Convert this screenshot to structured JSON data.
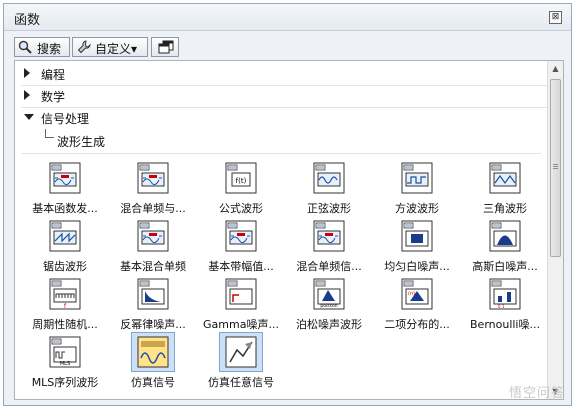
{
  "window": {
    "title": "函数",
    "close_glyph": "⊠"
  },
  "toolbar": {
    "search_label": "搜索",
    "customize_label": "自定义▾"
  },
  "categories": [
    {
      "label": "编程",
      "expanded": false
    },
    {
      "label": "数学",
      "expanded": false
    },
    {
      "label": "信号处理",
      "expanded": true
    }
  ],
  "subcategory": {
    "label": "波形生成"
  },
  "items": [
    {
      "label": "基本函数发...",
      "icon": "basic-function-icon"
    },
    {
      "label": "混合单频与...",
      "icon": "mixed-single-tone-icon"
    },
    {
      "label": "公式波形",
      "icon": "formula-waveform-icon",
      "glyph": "f(t)"
    },
    {
      "label": "正弦波形",
      "icon": "sine-waveform-icon"
    },
    {
      "label": "方波波形",
      "icon": "square-waveform-icon"
    },
    {
      "label": "三角波形",
      "icon": "triangle-waveform-icon"
    },
    {
      "label": "锯齿波形",
      "icon": "sawtooth-waveform-icon"
    },
    {
      "label": "基本混合单频",
      "icon": "basic-multitone-icon"
    },
    {
      "label": "基本带幅值...",
      "icon": "basic-amplitude-icon"
    },
    {
      "label": "混合单频信...",
      "icon": "multitone-signal-icon"
    },
    {
      "label": "均匀白噪声...",
      "icon": "uniform-white-noise-icon"
    },
    {
      "label": "高斯白噪声...",
      "icon": "gaussian-white-noise-icon"
    },
    {
      "label": "周期性随机...",
      "icon": "periodic-random-noise-icon"
    },
    {
      "label": "反幂律噪声...",
      "icon": "inverse-power-noise-icon"
    },
    {
      "label": "Gamma噪声...",
      "icon": "gamma-noise-icon"
    },
    {
      "label": "泊松噪声波形",
      "icon": "poisson-noise-icon",
      "glyph": "poisson"
    },
    {
      "label": "二项分布的...",
      "icon": "binomial-noise-icon"
    },
    {
      "label": "Bernoulli噪...",
      "icon": "bernoulli-noise-icon"
    },
    {
      "label": "MLS序列波形",
      "icon": "mls-sequence-icon",
      "glyph": "MLS"
    },
    {
      "label": "仿真信号",
      "icon": "simulate-signal-icon",
      "selected": true
    },
    {
      "label": "仿真任意信号",
      "icon": "simulate-arbitrary-icon",
      "selected": true
    }
  ],
  "watermark": "悟空问答"
}
